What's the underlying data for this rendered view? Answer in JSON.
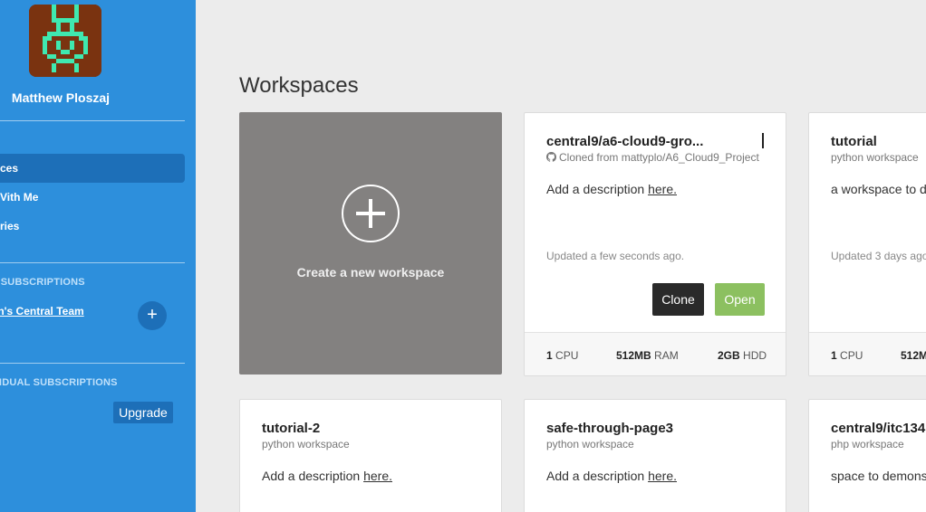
{
  "sidebar": {
    "user_name": "Matthew Ploszaj",
    "nav": [
      {
        "label": "ces",
        "active": true
      },
      {
        "label": "Vith Me",
        "active": false
      },
      {
        "label": "ries",
        "active": false
      }
    ],
    "team_subscriptions_title": "AM SUBSCRIPTIONS",
    "team_name": "man's Central Team",
    "add_team_label": "+",
    "individual_subscriptions_title": "DIVIDUAL SUBSCRIPTIONS",
    "upgrade_label": "Upgrade"
  },
  "main": {
    "title": "Workspaces",
    "create_label": "Create a new workspace",
    "workspaces": [
      {
        "name": "central9/a6-cloud9-gro...",
        "sub": "Cloned from mattyplo/A6_Cloud9_Project",
        "desc_prefix": "Add a description ",
        "desc_link": "here.",
        "updated": "Updated a few seconds ago.",
        "clone_label": "Clone",
        "open_label": "Open",
        "cpu_value": "1",
        "cpu_unit": "CPU",
        "ram_value": "512MB",
        "ram_unit": "RAM",
        "hdd_value": "2GB",
        "hdd_unit": "HDD"
      },
      {
        "name": "tutorial",
        "sub": "python workspace",
        "desc": "a workspace to d",
        "updated": "Updated 3 days ago",
        "cpu_value": "1",
        "cpu_unit": "CPU",
        "ram_value": "512M"
      },
      {
        "name": "tutorial-2",
        "sub": "python workspace",
        "desc_prefix": "Add a description ",
        "desc_link": "here."
      },
      {
        "name": "safe-through-page3",
        "sub": "python workspace",
        "desc_prefix": "Add a description ",
        "desc_link": "here."
      },
      {
        "name": "central9/itc134",
        "sub": "php workspace",
        "desc": "space to demons"
      }
    ]
  },
  "colors": {
    "sidebar": "#2d8fdc",
    "sidebar_active": "#1d6fb8",
    "open_button": "#8cc060",
    "clone_button": "#2a2a2a",
    "create_card": "#838180"
  },
  "icons": {
    "github": "github-icon",
    "plus": "plus-icon"
  }
}
